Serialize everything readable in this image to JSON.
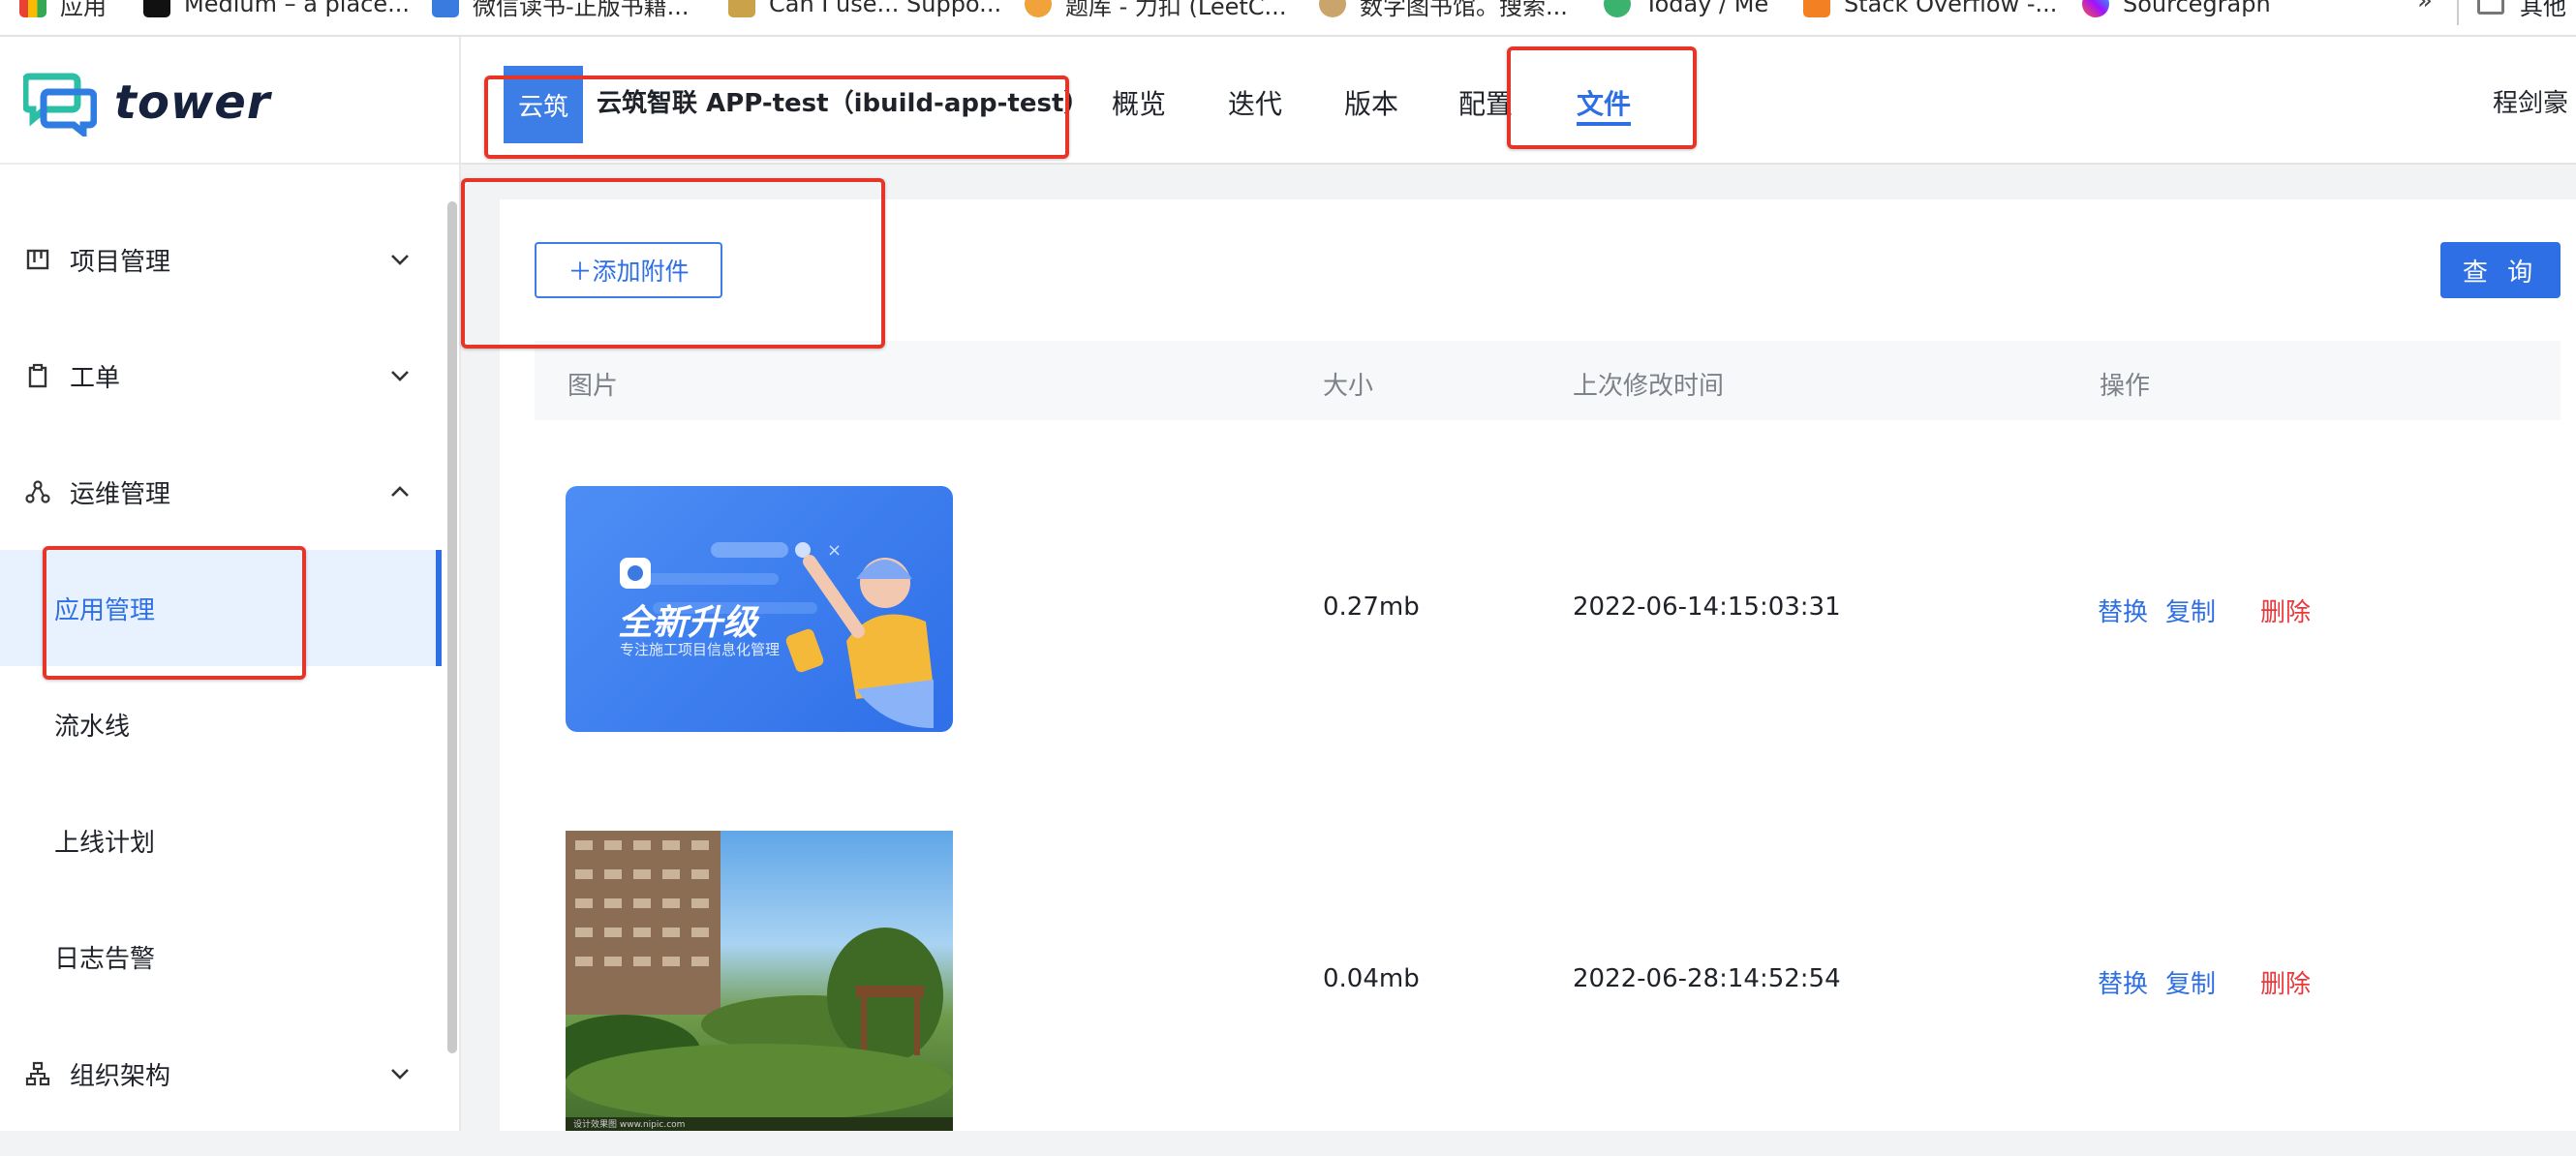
{
  "bookmarks": {
    "items": [
      {
        "label": "应用",
        "icon": "apps-grid-icon"
      },
      {
        "label": "Medium – a place...",
        "icon": "medium-icon"
      },
      {
        "label": "微信读书-正版书籍...",
        "icon": "wechat-read-icon"
      },
      {
        "label": "Can I use... Suppo...",
        "icon": "caniuse-icon"
      },
      {
        "label": "题库 - 力扣 (LeetC...",
        "icon": "leetcode-icon"
      },
      {
        "label": "数字图书馆。搜索...",
        "icon": "library-icon"
      },
      {
        "label": "Today / Me",
        "icon": "today-icon"
      },
      {
        "label": "Stack Overflow -...",
        "icon": "stackoverflow-icon"
      },
      {
        "label": "Sourcegraph",
        "icon": "sourcegraph-icon"
      }
    ],
    "more": "»",
    "other": "其他"
  },
  "logo": {
    "text": "tower"
  },
  "sidebar": {
    "groups": [
      {
        "label": "项目管理",
        "icon": "kanban-icon",
        "expanded": false
      },
      {
        "label": "工单",
        "icon": "clipboard-icon",
        "expanded": false
      },
      {
        "label": "运维管理",
        "icon": "ops-network-icon",
        "expanded": true
      },
      {
        "label": "组织架构",
        "icon": "org-tree-icon",
        "expanded": false
      }
    ],
    "subitems": [
      {
        "label": "应用管理",
        "active": true
      },
      {
        "label": "流水线",
        "active": false
      },
      {
        "label": "上线计划",
        "active": false
      },
      {
        "label": "日志告警",
        "active": false
      }
    ]
  },
  "header": {
    "project_badge": "云筑",
    "project_name": "云筑智联 APP-test（ibuild-app-test）",
    "tabs": [
      {
        "label": "概览",
        "active": false
      },
      {
        "label": "迭代",
        "active": false
      },
      {
        "label": "版本",
        "active": false
      },
      {
        "label": "配置",
        "active": false
      },
      {
        "label": "文件",
        "active": true
      }
    ],
    "user": "程剑豪"
  },
  "toolbar": {
    "add_label": "＋添加附件",
    "query_label": "查 询"
  },
  "table": {
    "columns": [
      "图片",
      "大小",
      "上次修改时间",
      "操作"
    ],
    "rows": [
      {
        "image": {
          "type": "promo-banner",
          "title": "全新升级",
          "subtitle": "专注施工项目信息化管理"
        },
        "size": "0.27mb",
        "modified": "2022-06-14:15:03:31",
        "actions": {
          "replace": "替换",
          "copy": "复制",
          "delete": "删除"
        }
      },
      {
        "image": {
          "type": "photo",
          "caption": "设计效果图 www.nipic.com"
        },
        "size": "0.04mb",
        "modified": "2022-06-28:14:52:54",
        "actions": {
          "replace": "替换",
          "copy": "复制",
          "delete": "删除"
        }
      }
    ]
  },
  "colors": {
    "accent": "#2e6fe5",
    "danger": "#e8383d",
    "annotation": "#e53528",
    "active_bg": "#e8f1fe"
  }
}
